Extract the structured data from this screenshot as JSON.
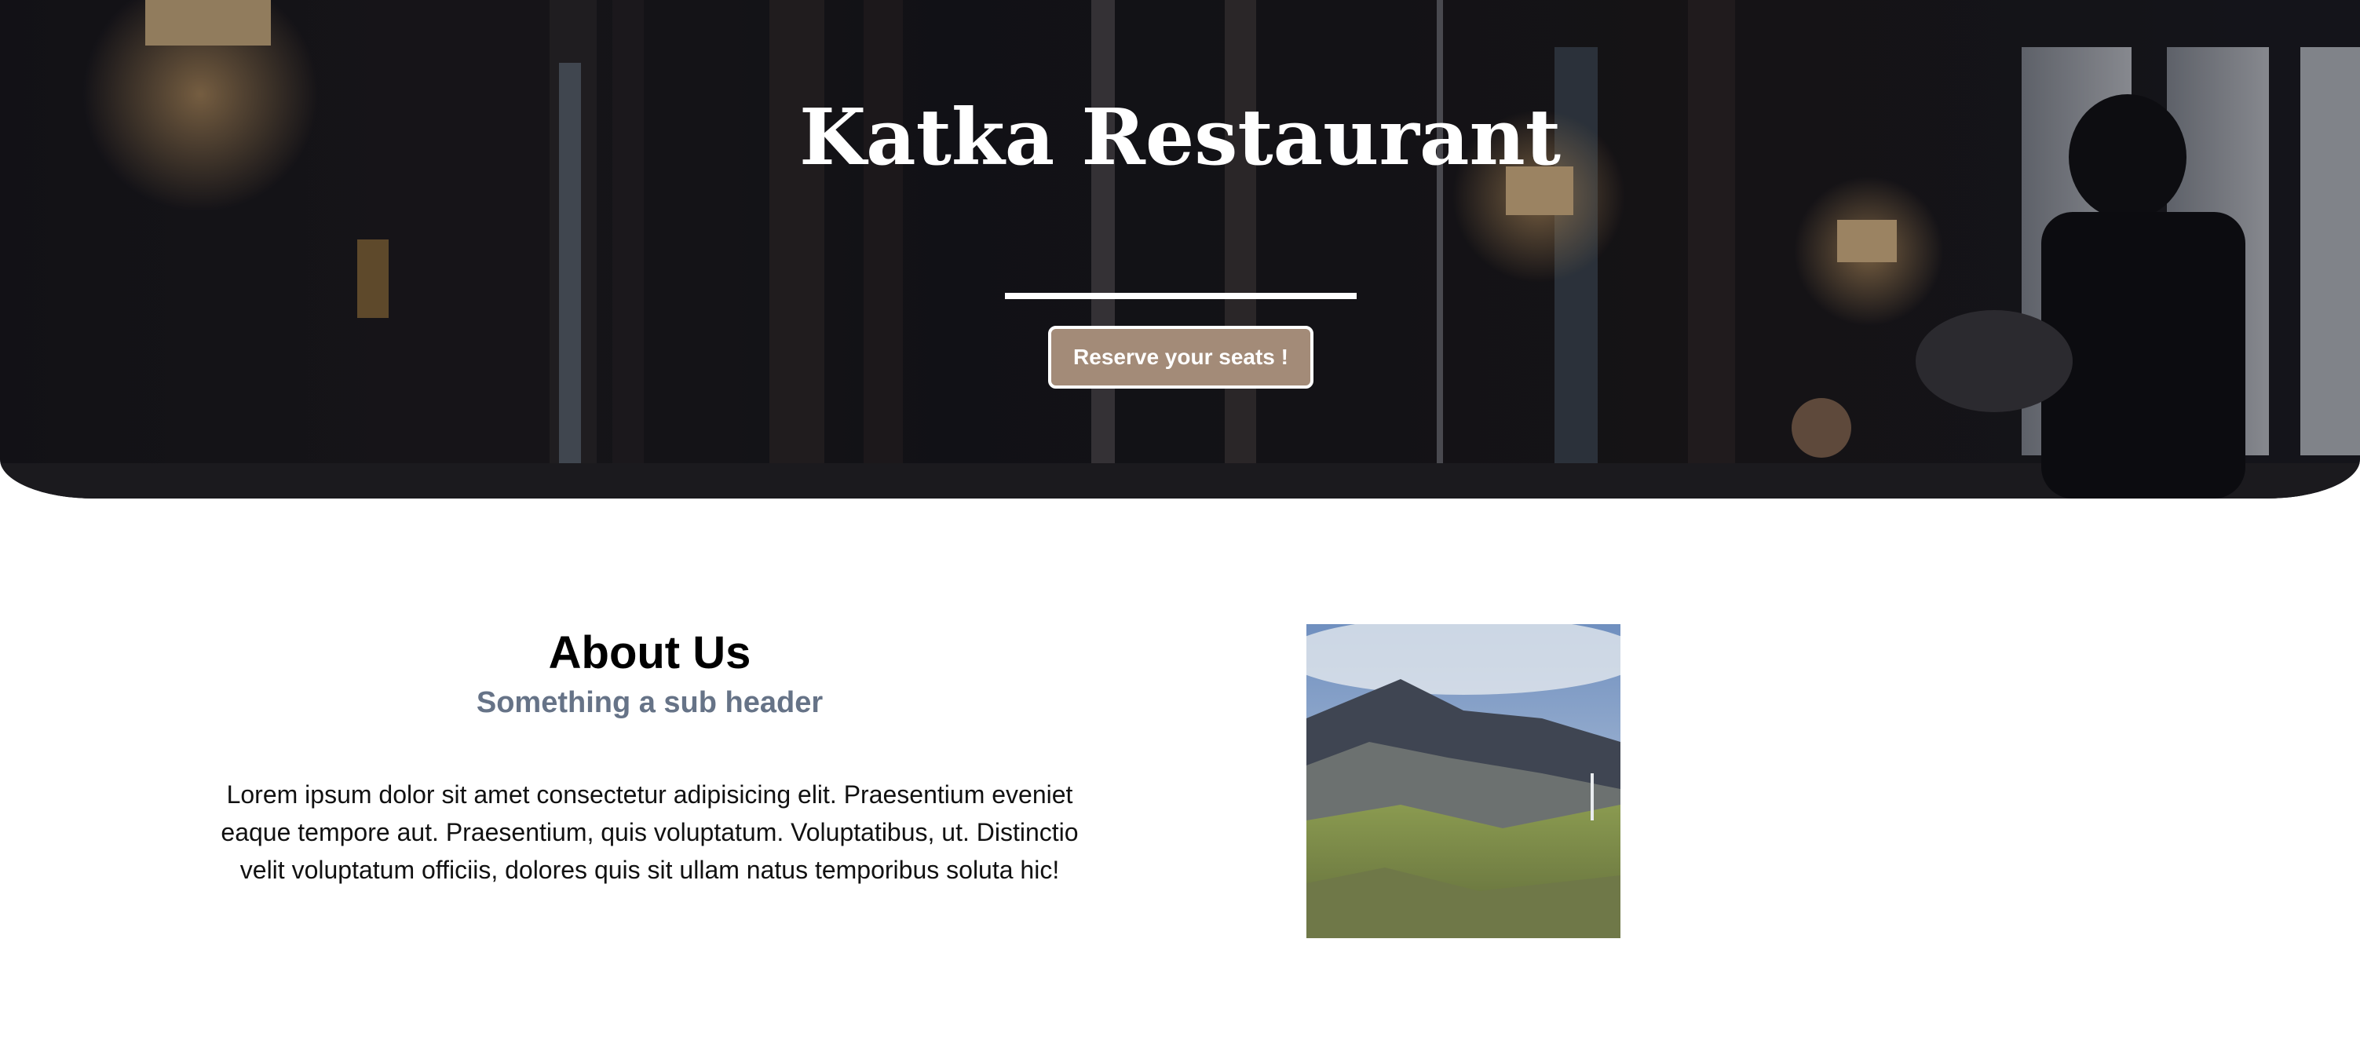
{
  "hero": {
    "title": "Katka Restaurant",
    "button_label": "Reserve your seats !"
  },
  "about": {
    "title": "About Us",
    "subtitle": "Something a sub header",
    "body": "Lorem ipsum dolor sit amet consectetur adipisicing elit. Praesentium eveniet eaque tempore aut. Praesentium, quis voluptatum. Voluptatibus, ut. Distinctio velit voluptatum officiis, dolores quis sit ullam natus temporibus soluta hic!"
  },
  "colors": {
    "accent": "#a38b78",
    "subheader": "#667387",
    "hero_dark": "#16151a"
  }
}
